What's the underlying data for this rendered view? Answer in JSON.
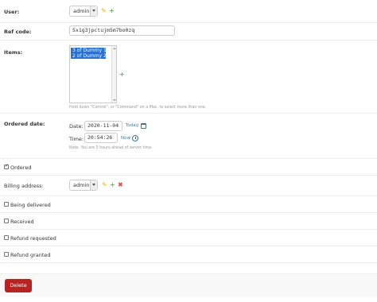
{
  "user": {
    "label": "User:",
    "value": "admin"
  },
  "ref_code": {
    "label": "Ref code:",
    "value": "5x1g3jpctujm5m7bo0zq"
  },
  "items": {
    "label": "Items:",
    "options": [
      "3 of Dummy 1",
      "2 of Dummy 2"
    ],
    "help": "Hold down \"Control\", or \"Command\" on a Mac, to select more than one."
  },
  "ordered_date": {
    "label": "Ordered date:",
    "date_label": "Date:",
    "date_value": "2020-11-04",
    "today_link": "Today",
    "sep": "|",
    "time_label": "Time:",
    "time_value": "20:54:26",
    "now_link": "Now",
    "help": "Note: You are 5 hours ahead of server time."
  },
  "ordered": {
    "label": "Ordered",
    "checked": true
  },
  "billing_address": {
    "label": "Billing address:",
    "value": "admin"
  },
  "being_delivered": {
    "label": "Being delivered",
    "checked": false
  },
  "received": {
    "label": "Received",
    "checked": false
  },
  "refund_requested": {
    "label": "Refund requested",
    "checked": false
  },
  "refund_granted": {
    "label": "Refund granted",
    "checked": false
  },
  "submit": {
    "delete_label": "Delete"
  },
  "colors": {
    "delete_bg": "#ba2121",
    "selected_option": "#2b6fd0",
    "link": "#447e9b"
  },
  "icons": {
    "change": "pencil-icon",
    "add": "plus-icon",
    "delete": "cross-icon",
    "calendar": "calendar-icon",
    "clock": "clock-icon"
  }
}
